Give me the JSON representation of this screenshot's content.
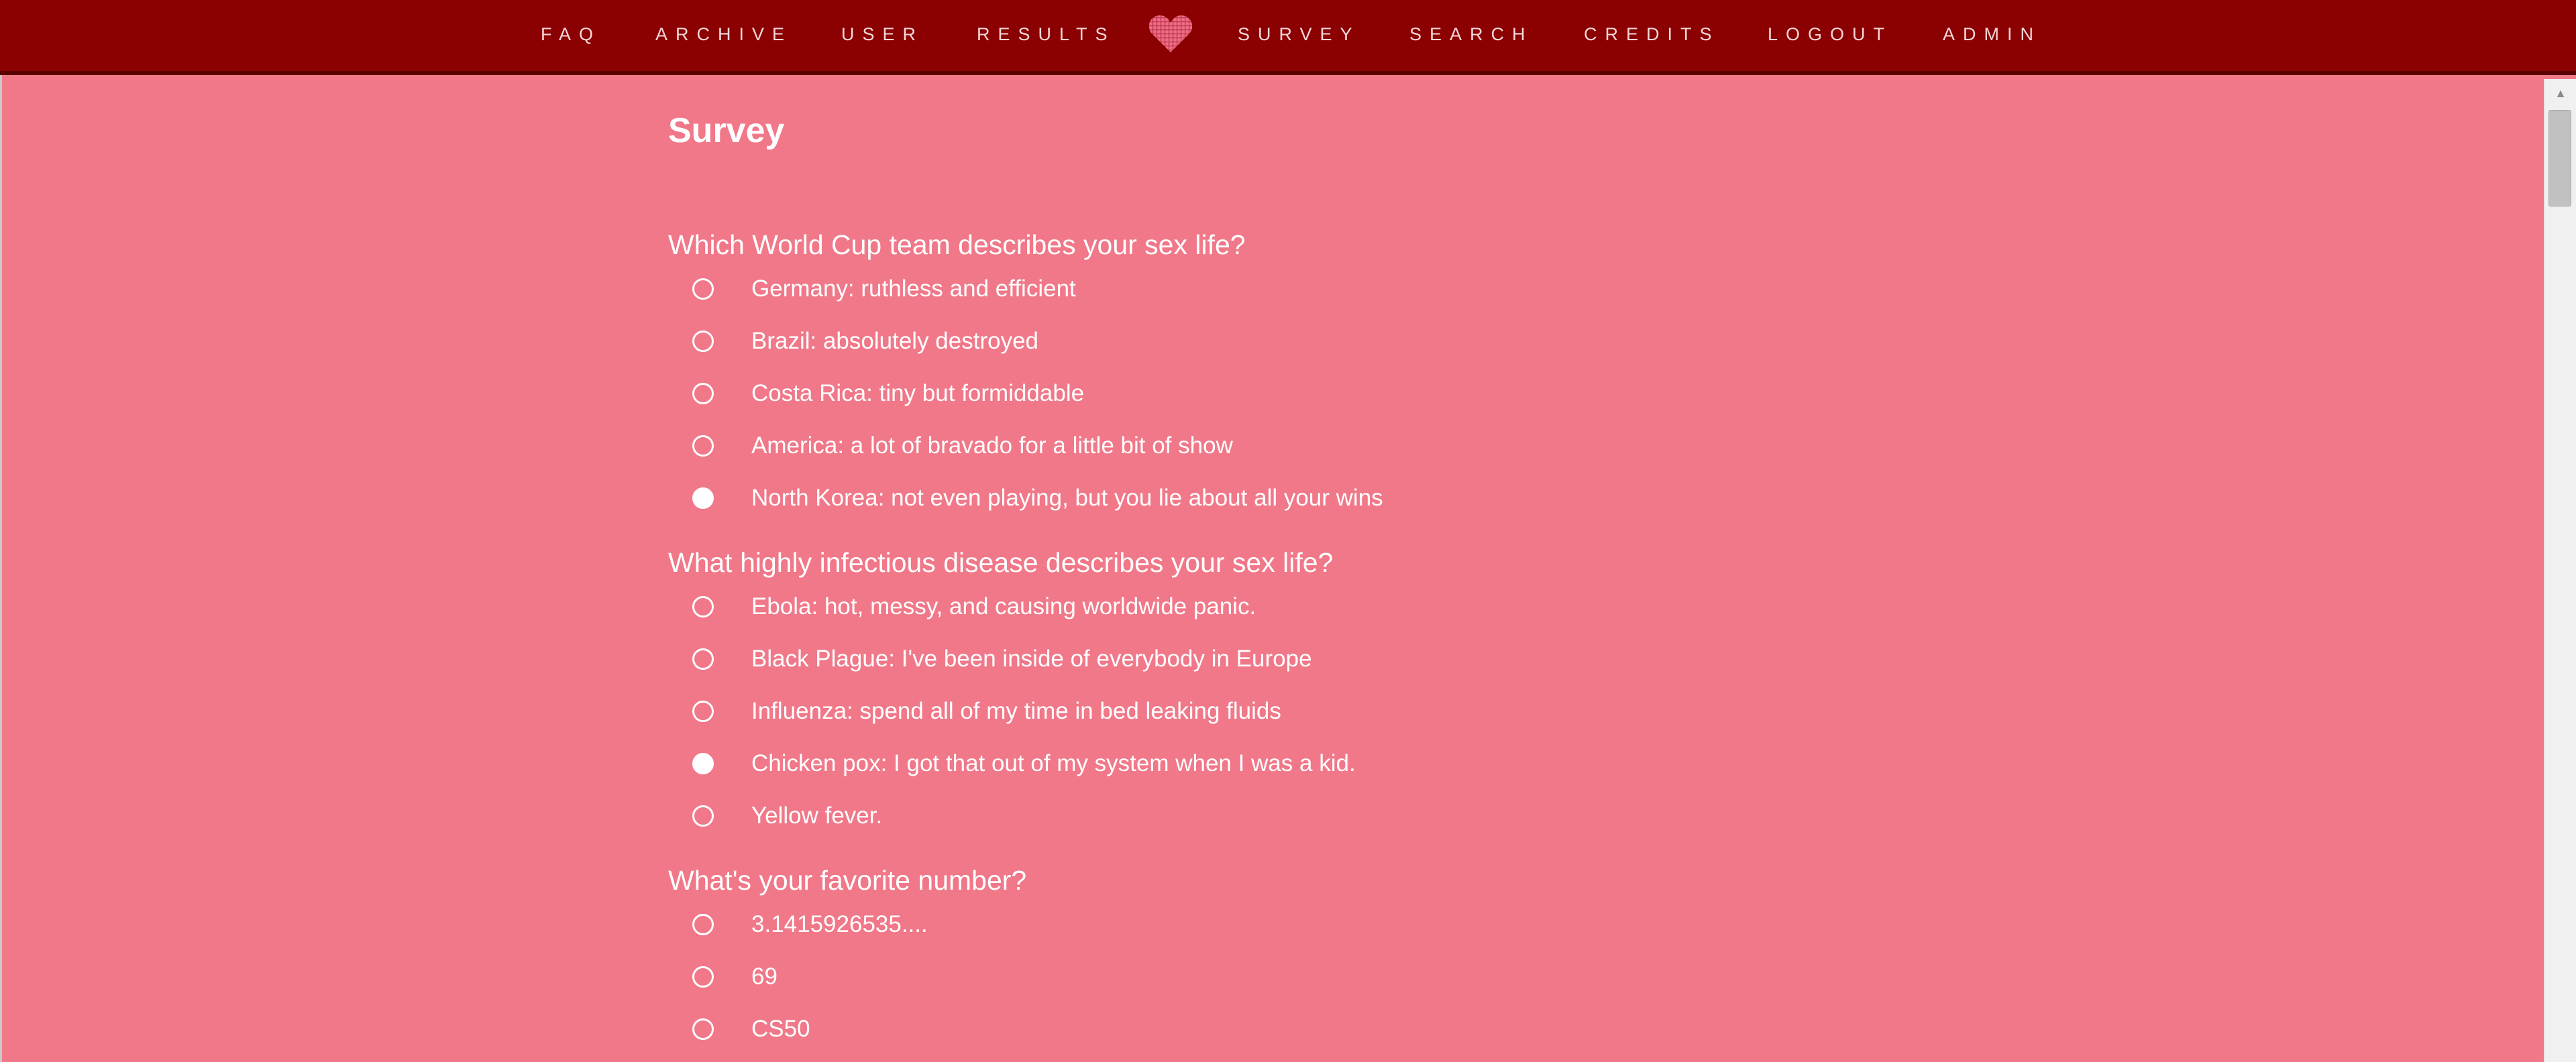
{
  "nav": {
    "left_items": [
      {
        "label": "FAQ"
      },
      {
        "label": "ARCHIVE"
      },
      {
        "label": "USER"
      },
      {
        "label": "RESULTS"
      }
    ],
    "logo": {
      "icon": "heart-icon",
      "color": "#f06f86"
    },
    "right_items": [
      {
        "label": "SURVEY"
      },
      {
        "label": "SEARCH"
      },
      {
        "label": "CREDITS"
      },
      {
        "label": "LOGOUT"
      },
      {
        "label": "ADMIN"
      }
    ]
  },
  "page": {
    "title": "Survey"
  },
  "colors": {
    "background": "#f07889",
    "nav_background": "#8b0000",
    "text": "#ffffff"
  },
  "survey": {
    "questions": [
      {
        "text": "Which World Cup team describes your sex life?",
        "options": [
          {
            "label": "Germany: ruthless and efficient",
            "selected": false
          },
          {
            "label": "Brazil: absolutely destroyed",
            "selected": false
          },
          {
            "label": "Costa Rica: tiny but formiddable",
            "selected": false
          },
          {
            "label": "America: a lot of bravado for a little bit of show",
            "selected": false
          },
          {
            "label": "North Korea: not even playing, but you lie about all your wins",
            "selected": true
          }
        ]
      },
      {
        "text": "What highly infectious disease describes your sex life?",
        "options": [
          {
            "label": "Ebola: hot, messy, and causing worldwide panic.",
            "selected": false
          },
          {
            "label": "Black Plague: I've been inside of everybody in Europe",
            "selected": false
          },
          {
            "label": "Influenza: spend all of my time in bed leaking fluids",
            "selected": false
          },
          {
            "label": "Chicken pox: I got that out of my system when I was a kid.",
            "selected": true
          },
          {
            "label": "Yellow fever.",
            "selected": false
          }
        ]
      },
      {
        "text": "What's your favorite number?",
        "options": [
          {
            "label": "3.1415926535....",
            "selected": false
          },
          {
            "label": "69",
            "selected": false
          },
          {
            "label": "CS50",
            "selected": false
          }
        ]
      }
    ]
  }
}
